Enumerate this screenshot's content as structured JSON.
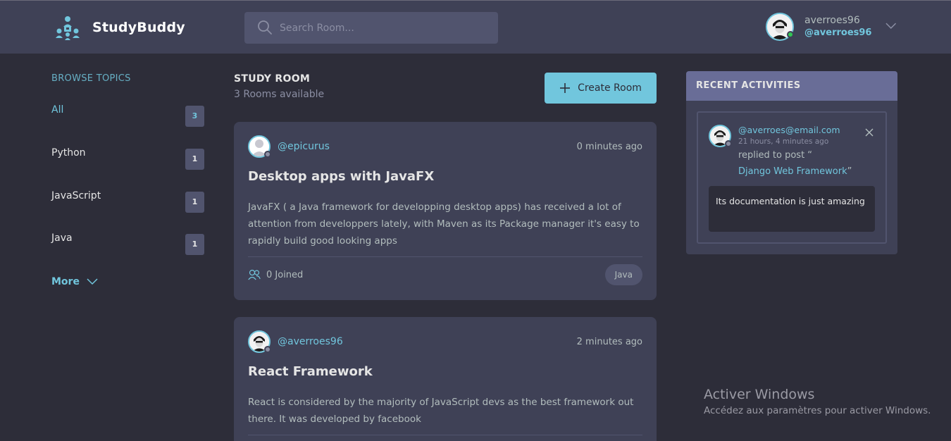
{
  "header": {
    "brand": "StudyBuddy",
    "search_placeholder": "Search Room...",
    "user": {
      "name": "averroes96",
      "handle": "@averroes96"
    }
  },
  "sidebar": {
    "title": "BROWSE TOPICS",
    "topics": [
      {
        "label": "All",
        "count": "3"
      },
      {
        "label": "Python",
        "count": "1"
      },
      {
        "label": "JavaScript",
        "count": "1"
      },
      {
        "label": "Java",
        "count": "1"
      }
    ],
    "more_label": "More"
  },
  "main": {
    "title": "STUDY ROOM",
    "subtitle": "3 Rooms available",
    "create_label": "Create Room",
    "rooms": [
      {
        "host": "@epicurus",
        "time": "0 minutes ago",
        "title": "Desktop apps with JavaFX",
        "description": "JavaFX ( a Java framework for developping desktop apps) has received a lot of attention from developpers lately, with Maven as its Package manager it's easy to rapidly build good looking apps",
        "joined": "0 Joined",
        "topic": "Java"
      },
      {
        "host": "@averroes96",
        "time": "2 minutes ago",
        "title": "React Framework",
        "description": "React is considered by the majority of JavaScript devs as the best framework out there. It was developed by facebook"
      }
    ]
  },
  "activities": {
    "title": "RECENT ACTIVITIES",
    "items": [
      {
        "user": "@averroes@email.com",
        "time": "21 hours, 4 minutes ago",
        "action": "replied to post “",
        "post": "Django Web Framework",
        "post_close": "”",
        "quote": "Its documentation is just amazing"
      }
    ]
  },
  "watermark": {
    "title": "Activer Windows",
    "subtitle": "Accédez aux paramètres pour activer Windows."
  },
  "colors": {
    "accent": "#71c6dd",
    "background": "#2d2d39",
    "surface": "#3f4156",
    "activities_header": "#696d97"
  }
}
